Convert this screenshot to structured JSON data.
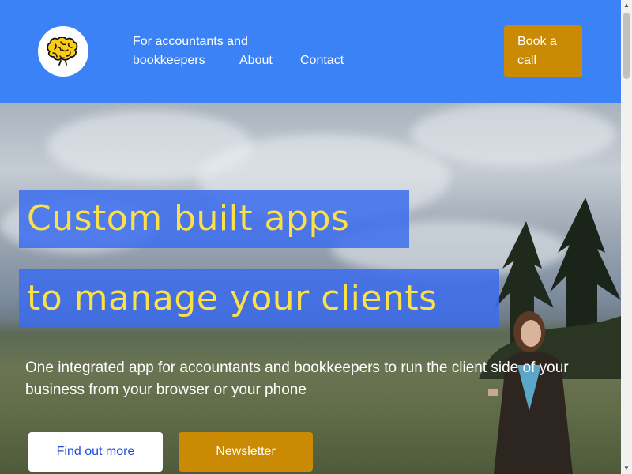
{
  "header": {
    "logo_icon": "brain-icon",
    "nav": {
      "accountants": "For accountants and bookkeepers",
      "about": "About",
      "contact": "Contact"
    },
    "book_call": "Book a call"
  },
  "hero": {
    "headline_line1": "Custom built apps",
    "headline_line2": "to manage your clients",
    "subtitle": "One integrated app for accountants and bookkeepers to run the client side of your business from your browser or your phone",
    "find_out_more": "Find out more",
    "newsletter": "Newsletter"
  },
  "colors": {
    "header_bg": "#3b82f6",
    "accent_gold": "#ca8a04",
    "headline_text": "#fde047",
    "headline_bg": "#3b6cee"
  }
}
